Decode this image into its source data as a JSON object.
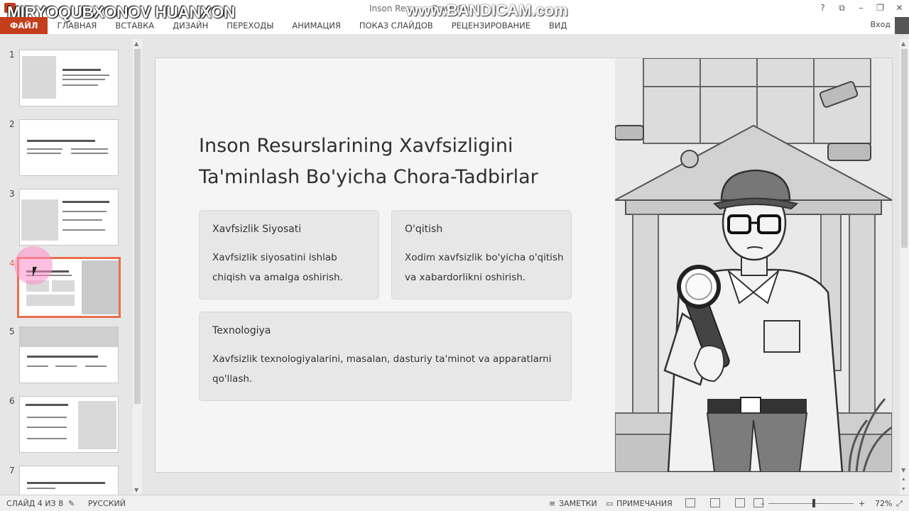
{
  "window": {
    "overlay_name": "MIRYOQUBXONOV HUANXON",
    "title": "Inson Resu... - PowerPoint",
    "watermark": "www.BANDICAM.com",
    "controls": [
      "?",
      "⧉",
      "–",
      "❐",
      "✕"
    ],
    "login": "Вход"
  },
  "ribbon": {
    "tabs": [
      "ФАЙЛ",
      "ГЛАВНАЯ",
      "ВСТАВКА",
      "ДИЗАЙН",
      "ПЕРЕХОДЫ",
      "АНИМАЦИЯ",
      "ПОКАЗ СЛАЙДОВ",
      "РЕЦЕНЗИРОВАНИЕ",
      "ВИД"
    ]
  },
  "thumbnails": {
    "numbers": [
      "1",
      "2",
      "3",
      "4",
      "5",
      "6",
      "7"
    ],
    "active_index": 4
  },
  "slide": {
    "title_line1": "Inson Resurslarining Xavfsizligini",
    "title_line2": "Ta'minlash Bo'yicha Chora-Tadbirlar",
    "cards": [
      {
        "title": "Xavfsizlik Siyosati",
        "text": "Xavfsizlik siyosatini ishlab chiqish va amalga oshirish."
      },
      {
        "title": "O'qitish",
        "text": "Xodim xavfsizlik bo'yicha o'qitish va xabardorlikni oshirish."
      },
      {
        "title": "Texnologiya",
        "text": "Xavfsizlik texnologiyalarini, masalan, dasturiy ta'minot va apparatlarni qo'llash."
      }
    ]
  },
  "statusbar": {
    "slide_info": "СЛАЙД 4 ИЗ 8",
    "language": "РУССКИЙ",
    "notes": "ЗАМЕТКИ",
    "comments": "ПРИМЕЧАНИЯ",
    "zoom": "72%",
    "zoom_minus": "–",
    "zoom_plus": "+"
  },
  "colors": {
    "accent": "#c43e1c",
    "active_thumb_border": "#e86e4d"
  }
}
